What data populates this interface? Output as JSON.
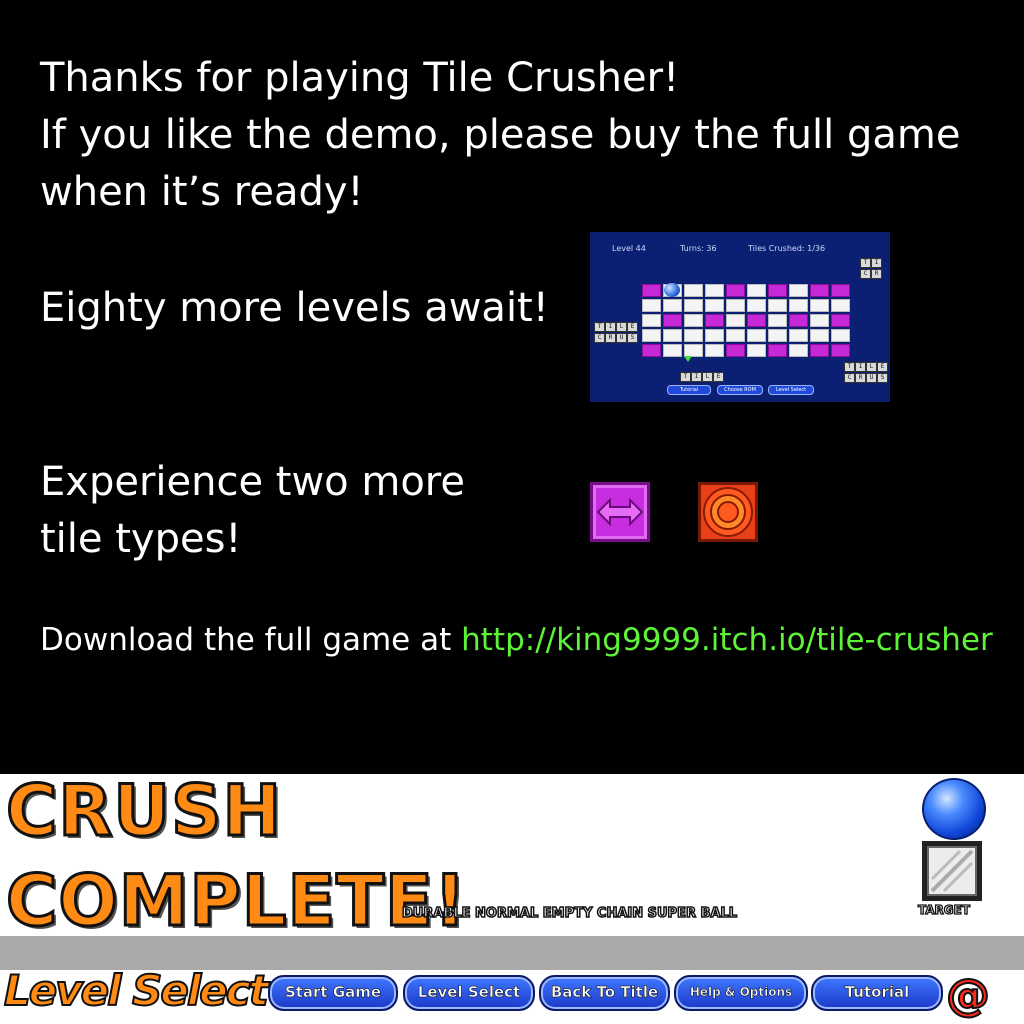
{
  "message": {
    "line1": "Thanks for playing Tile Crusher!",
    "line2": "If you like the demo, please buy the full game",
    "line3": "when it’s ready!",
    "levels": "Eighty more levels await!",
    "tiles1": "Experience two more",
    "tiles2": "tile types!",
    "download_prefix": "Download the full game at",
    "download_url": "http://king9999.itch.io/tile-crusher"
  },
  "preview": {
    "level": "Level 44",
    "turns": "Turns: 36",
    "tiles_crushed": "Tiles Crushed: 1/36",
    "buttons": [
      "Tutorial",
      "Choose ROM",
      "Level Select"
    ]
  },
  "new_tiles": [
    {
      "name": "chain-tile",
      "color": "#c72ee0"
    },
    {
      "name": "target-tile",
      "color": "#e8411a"
    }
  ],
  "status": {
    "line1": "CRUSH",
    "line2": "COMPLETE!",
    "legend": "DURABLE NORMAL EMPTY CHAIN SUPER BALL",
    "target_label": "TARGET"
  },
  "nav": {
    "title": "Level Select",
    "buttons": [
      "Start Game",
      "Level Select",
      "Back To Title",
      "Help & Options",
      "Tutorial"
    ],
    "at_symbol": "@"
  },
  "colors": {
    "background": "#000000",
    "link": "#5ef238",
    "accent_orange": "#ff8a14",
    "button_blue": "#2a50e0"
  }
}
